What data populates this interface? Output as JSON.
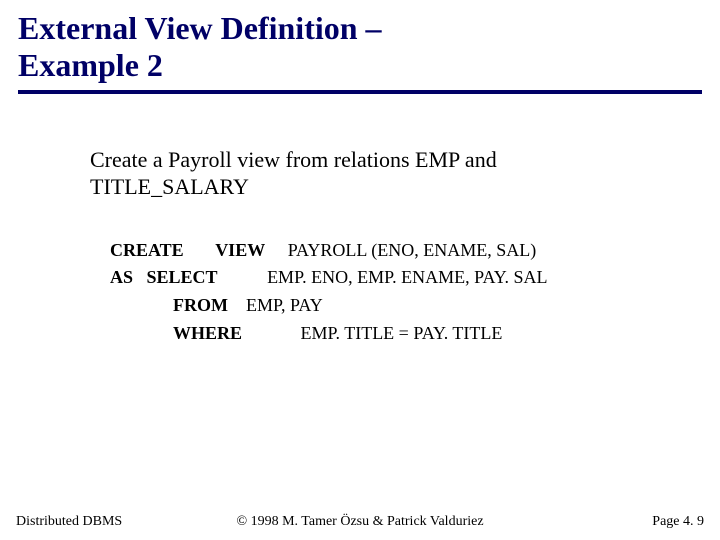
{
  "title_line1": "External View Definition –",
  "title_line2": "Example 2",
  "intro": "Create a Payroll view from relations EMP and TITLE_SALARY",
  "sql": {
    "kw_create": "CREATE",
    "kw_view": "VIEW",
    "view_name": "PAYROLL (ENO, ENAME, SAL)",
    "kw_as": "AS",
    "kw_select": "SELECT",
    "select_list": "EMP. ENO, EMP. ENAME, PAY. SAL",
    "kw_from": "FROM",
    "from_list": "EMP, PAY",
    "kw_where": "WHERE",
    "where_clause": "EMP. TITLE = PAY. TITLE"
  },
  "footer": {
    "left": "Distributed DBMS",
    "center": "© 1998 M. Tamer Özsu & Patrick Valduriez",
    "right": "Page 4. 9"
  }
}
